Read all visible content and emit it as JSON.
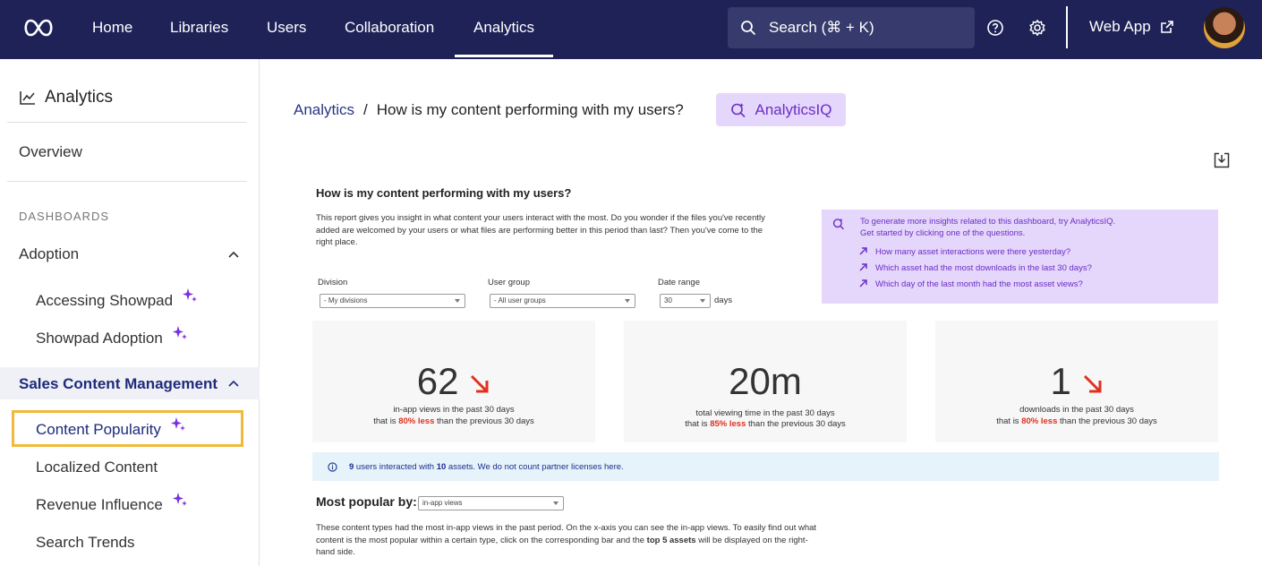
{
  "nav": {
    "items": [
      {
        "label": "Home",
        "active": false
      },
      {
        "label": "Libraries",
        "active": false
      },
      {
        "label": "Users",
        "active": false
      },
      {
        "label": "Collaboration",
        "active": false
      },
      {
        "label": "Analytics",
        "active": true
      }
    ],
    "search_label": "Search (⌘ + K)",
    "web_app_label": "Web App"
  },
  "sidebar": {
    "title": "Analytics",
    "overview": "Overview",
    "section_label": "DASHBOARDS",
    "groups": [
      {
        "label": "Adoption",
        "expanded": true,
        "items": [
          {
            "label": "Accessing Showpad",
            "sparkle": true
          },
          {
            "label": "Showpad Adoption",
            "sparkle": true
          }
        ]
      },
      {
        "label": "Sales Content Management",
        "expanded": true,
        "active": true,
        "items": [
          {
            "label": "Content Popularity",
            "sparkle": true,
            "selected": true
          },
          {
            "label": "Localized Content",
            "sparkle": false
          },
          {
            "label": "Revenue Influence",
            "sparkle": true
          },
          {
            "label": "Search Trends",
            "sparkle": false
          }
        ]
      }
    ]
  },
  "breadcrumb": {
    "root": "Analytics",
    "separator": "/",
    "current": "How is my content performing with my users?"
  },
  "analyticsiq_button": "AnalyticsIQ",
  "report": {
    "title": "How is my content performing with my users?",
    "description": "This report gives you insight in what content your users interact with the most. Do you wonder if the files you've recently added are welcomed by your users or what files are performing better in this period than last? Then you've come to the right place.",
    "aiq_panel": {
      "intro_line1": "To generate more insights related to this dashboard, try AnalyticsIQ.",
      "intro_line2": "Get started by clicking one of the questions.",
      "questions": [
        "How many asset interactions were there yesterday?",
        "Which asset had the most downloads in the last 30 days?",
        "Which day of the last month had the most asset views?"
      ]
    },
    "filters": {
      "division_label": "Division",
      "division_value": "- My divisions",
      "user_group_label": "User group",
      "user_group_value": "- All user groups",
      "date_range_label": "Date range",
      "date_range_value": "30",
      "date_range_unit": "days"
    },
    "kpis": [
      {
        "value": "62",
        "trend": "down",
        "line1": "in-app views in the past 30 days",
        "prefix": "that is ",
        "delta": "80% less",
        "suffix": " than the previous 30 days"
      },
      {
        "value": "20m",
        "trend": "none",
        "line1": "total viewing time in the past 30 days",
        "prefix": "that is ",
        "delta": "85% less",
        "suffix": " than the previous 30 days"
      },
      {
        "value": "1",
        "trend": "down",
        "line1": "downloads in the past 30 days",
        "prefix": "that is ",
        "delta": "80% less",
        "suffix": " than the previous 30 days"
      }
    ],
    "info": {
      "users_count": "9",
      "text_a": " users interacted with ",
      "assets_count": "10",
      "text_b": " assets. We do not count partner licenses here."
    },
    "most_popular": {
      "title": "Most popular by:",
      "select_value": "in-app views",
      "desc_a": "These content types had the most in-app views in the past period. On the x-axis you can see the in-app views. To easily find out what content is the most popular within a certain type, click on the corresponding bar and the ",
      "desc_bold": "top 5 assets",
      "desc_b": " will be displayed on the right-hand side."
    }
  },
  "colors": {
    "nav_bg": "#1e2257",
    "accent_purple": "#6b2fc4",
    "aiq_bg": "#e5d6fb",
    "trend_down": "#e03020",
    "selected_outline": "#f0b93b"
  }
}
